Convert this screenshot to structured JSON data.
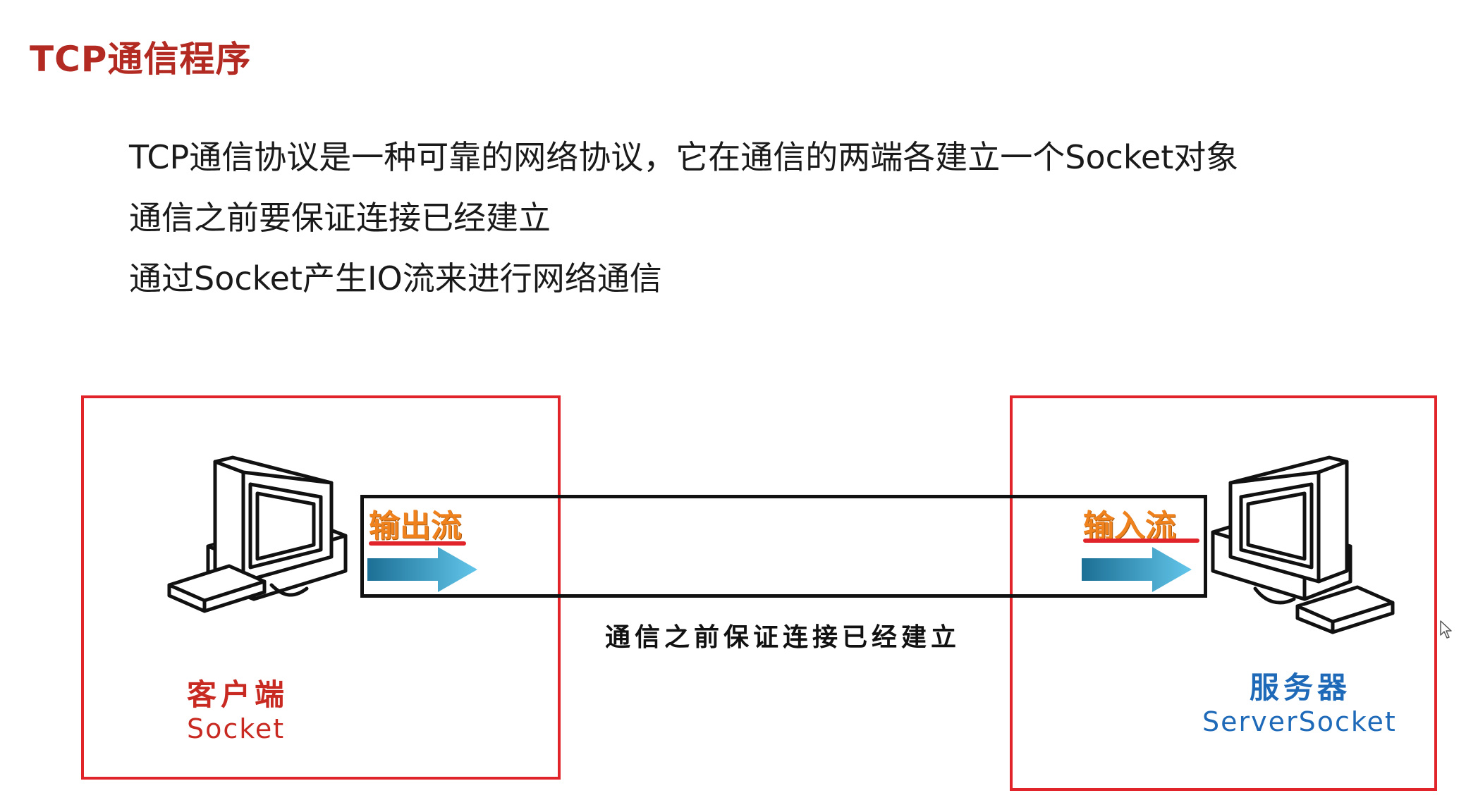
{
  "title": "TCP通信程序",
  "bullets": [
    "TCP通信协议是一种可靠的网络协议，它在通信的两端各建立一个Socket对象",
    "通信之前要保证连接已经建立",
    "通过Socket产生IO流来进行网络通信"
  ],
  "diagram": {
    "output_stream_label": "输出流",
    "input_stream_label": "输入流",
    "connection_caption": "通信之前保证连接已经建立",
    "client": {
      "name": "客户端",
      "socket": "Socket"
    },
    "server": {
      "name": "服务器",
      "socket": "ServerSocket"
    },
    "colors": {
      "title": "#b22a22",
      "frame": "#e0242a",
      "stream_label": "#f0821e",
      "arrow": "#3aaed8",
      "client_text": "#c82a22",
      "server_text": "#1f6ab8"
    },
    "icons": [
      "computer-icon",
      "arrow-right-icon",
      "mouse-cursor-icon"
    ]
  }
}
